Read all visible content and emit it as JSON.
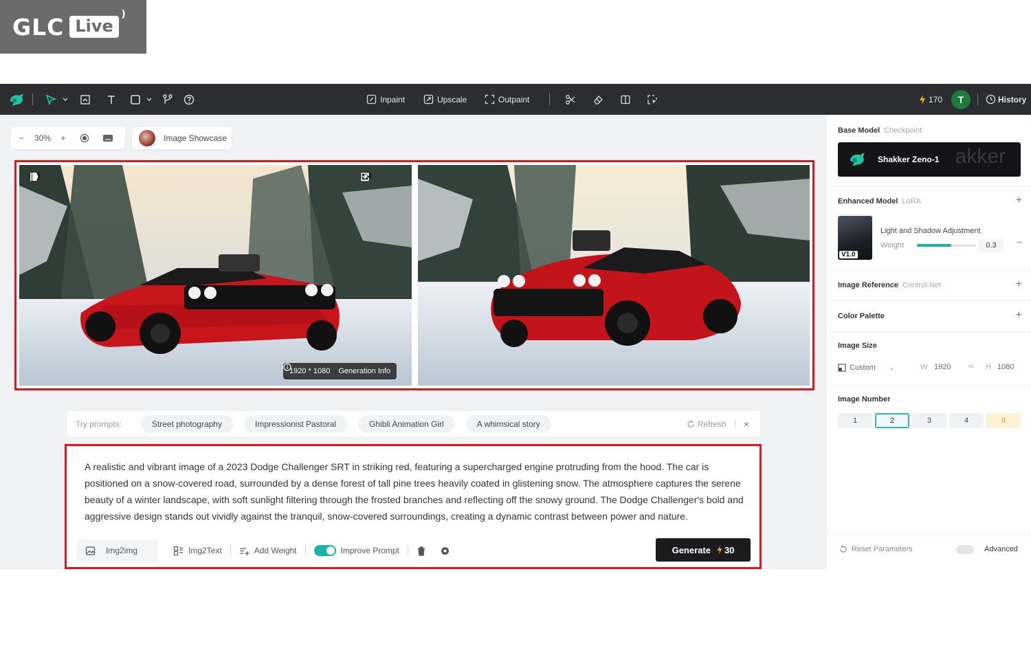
{
  "logo": {
    "brand": "GLC",
    "badge": "Live"
  },
  "colors": {
    "accent": "#1db3a8",
    "highlight_border": "#e0161f",
    "toolbar_bg": "#2b2d31"
  },
  "toolbar": {
    "logo_icon": "shakker-logo-icon",
    "tools": [
      {
        "name": "select-arrow-icon"
      },
      {
        "name": "image-import-icon"
      },
      {
        "name": "text-tool-icon"
      },
      {
        "name": "shape-tool-icon"
      },
      {
        "name": "branch-icon"
      },
      {
        "name": "help-icon"
      }
    ],
    "inpaint_label": "Inpaint",
    "upscale_label": "Upscale",
    "outpaint_label": "Outpaint",
    "credits": "170",
    "avatar_letter": "T",
    "history_label": "History"
  },
  "canvas": {
    "zoom": "30%",
    "showcase_label": "Image Showcase",
    "image_info": {
      "resolution": "1920 * 1080",
      "generation_info_label": "Generation Info"
    }
  },
  "prompts": {
    "label": "Try prompts:",
    "chips": [
      "Street photography",
      "Impressionist Pastoral",
      "Ghibli Animation Girl",
      "A whimsical story"
    ],
    "refresh_label": "Refresh"
  },
  "prompt_box": {
    "text": "A realistic and vibrant image of a 2023 Dodge Challenger SRT in striking red, featuring a supercharged engine protruding from the hood. The car is positioned on a snow-covered road, surrounded by a dense forest of tall pine trees heavily coated in glistening snow. The atmosphere captures the serene beauty of a winter landscape, with soft sunlight filtering through the frosted branches and reflecting off the snowy ground. The Dodge Challenger's bold and aggressive design stands out vividly against the tranquil, snow-covered surroundings, creating a dynamic contrast between power and nature.",
    "img2img_label": "Img2img",
    "img2text_label": "Img2Text",
    "add_weight_label": "Add Weight",
    "improve_prompt_label": "Improve Prompt",
    "improve_prompt_on": true,
    "generate_label": "Generate",
    "generate_cost": "30"
  },
  "panel": {
    "base_model": {
      "title": "Base Model",
      "subtitle": "Checkpoint",
      "name": "Shakker Zeno-1",
      "watermark": "akker"
    },
    "enhanced_model": {
      "title": "Enhanced Model",
      "subtitle": "LoRA",
      "lora_name": "Light and Shadow Adjustment",
      "version": "V1.0",
      "weight_label": "Weight",
      "weight_value": "0.3",
      "weight_fraction": 0.58
    },
    "image_reference": {
      "title": "Image Reference",
      "subtitle": "Control-Net"
    },
    "color_palette": {
      "title": "Color Palette"
    },
    "image_size": {
      "title": "Image Size",
      "preset": "Custom",
      "w_label": "W",
      "width": "1920",
      "h_label": "H",
      "height": "1080"
    },
    "image_number": {
      "title": "Image Number",
      "options": [
        "1",
        "2",
        "3",
        "4",
        "8"
      ],
      "selected": "2"
    },
    "reset_label": "Reset Parameters",
    "advanced_label": "Advanced"
  }
}
